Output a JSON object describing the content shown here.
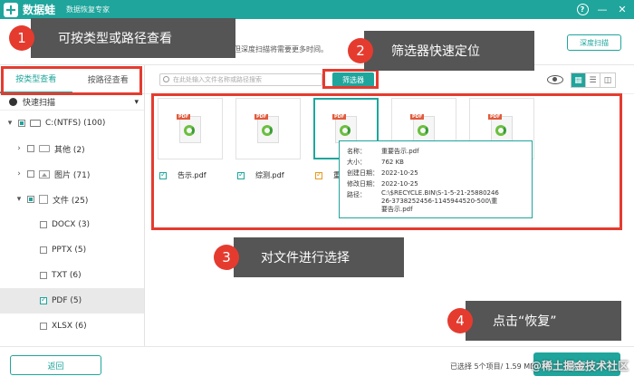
{
  "titlebar": {
    "app_name": "数据蛙",
    "subtitle": "数据恢复专家",
    "help": "?",
    "minimize": "—",
    "close": "✕"
  },
  "header": {
    "scan_hint": "但深度扫描将需要更多时间。",
    "deep_scan_label": "深度扫描"
  },
  "sidebar": {
    "tabs": [
      {
        "label": "按类型查看",
        "active": true
      },
      {
        "label": "按路径查看",
        "active": false
      }
    ],
    "quick_scan": "快速扫描",
    "tree": [
      {
        "label": "C:(NTFS) (100)",
        "toggle": "▾",
        "icon": "drive-icon"
      },
      {
        "label": "其他 (2)",
        "toggle": "›",
        "icon": "folder-icon"
      },
      {
        "label": "图片 (71)",
        "toggle": "›",
        "icon": "image-icon"
      },
      {
        "label": "文件 (25)",
        "toggle": "▾",
        "icon": "document-icon"
      },
      {
        "label": "DOCX (3)",
        "toggle": "",
        "icon": ""
      },
      {
        "label": "PPTX (5)",
        "toggle": "",
        "icon": ""
      },
      {
        "label": "TXT (6)",
        "toggle": "",
        "icon": ""
      },
      {
        "label": "PDF (5)",
        "toggle": "",
        "icon": "",
        "selected": true
      },
      {
        "label": "XLSX (6)",
        "toggle": "",
        "icon": ""
      }
    ]
  },
  "toolbar": {
    "search_placeholder": "在此处输入文件名称或路径搜索",
    "filter_label": "筛选器"
  },
  "files": [
    {
      "name": "告示.pdf",
      "tag": "PDF"
    },
    {
      "name": "综测.pdf",
      "tag": "PDF"
    },
    {
      "name": "重",
      "tag": "PDF"
    },
    {
      "name": "",
      "tag": "PDF"
    },
    {
      "name": "",
      "tag": "PDF"
    }
  ],
  "tooltip": {
    "name_key": "名称：",
    "name_val": "重要告示.pdf",
    "size_key": "大小：",
    "size_val": "762 KB",
    "created_key": "创建日期：",
    "created_val": "2022-10-25",
    "modified_key": "修改日期：",
    "modified_val": "2022-10-25",
    "path_key": "路径：",
    "path_val": "C:\\$RECYCLE.BIN\\S-1-5-21-2588024626-3738252456-1145944520-500\\重要告示.pdf"
  },
  "callouts": [
    {
      "num": "1",
      "text": "可按类型或路径查看"
    },
    {
      "num": "2",
      "text": "筛选器快速定位"
    },
    {
      "num": "3",
      "text": "对文件进行选择"
    },
    {
      "num": "4",
      "text": "点击“恢复”"
    }
  ],
  "bottom": {
    "back_label": "返回",
    "selected_info": "已选择 5个项目/ 1.59 MB",
    "restore_label": "恢复",
    "watermark": "@稀土掘金技术社区"
  },
  "colors": {
    "brand": "#1fa59c",
    "callout_badge": "#e53b2f",
    "callout_bg": "#555555"
  }
}
